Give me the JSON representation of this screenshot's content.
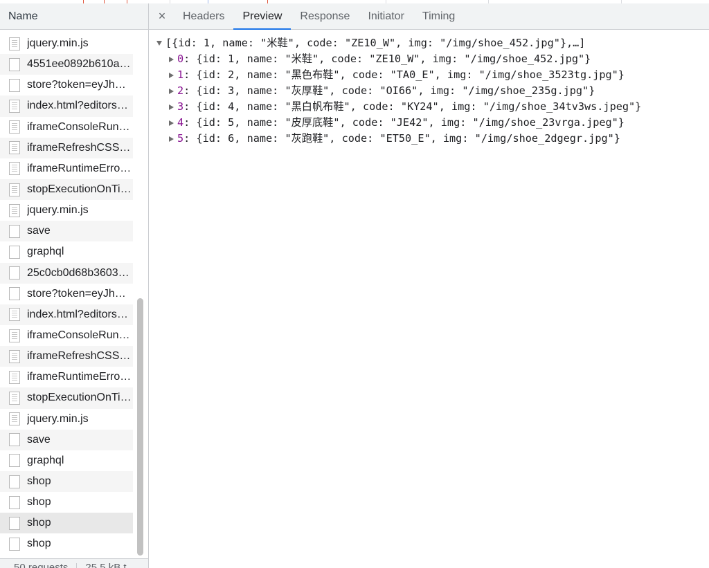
{
  "name_panel": {
    "header": "Name",
    "requests": [
      {
        "name": "jquery.min.js",
        "icon": "script-file-icon"
      },
      {
        "name": "4551ee0892b610a…",
        "icon": "document-file-icon"
      },
      {
        "name": "store?token=eyJhb…",
        "icon": "document-file-icon"
      },
      {
        "name": "index.html?editors…",
        "icon": "script-file-icon"
      },
      {
        "name": "iframeConsoleRun…",
        "icon": "script-file-icon"
      },
      {
        "name": "iframeRefreshCSS-…",
        "icon": "script-file-icon"
      },
      {
        "name": "iframeRuntimeError…",
        "icon": "script-file-icon"
      },
      {
        "name": "stopExecutionOnTi…",
        "icon": "script-file-icon"
      },
      {
        "name": "jquery.min.js",
        "icon": "script-file-icon"
      },
      {
        "name": "save",
        "icon": "document-file-icon"
      },
      {
        "name": "graphql",
        "icon": "document-file-icon"
      },
      {
        "name": "25c0cb0d68b3603…",
        "icon": "document-file-icon"
      },
      {
        "name": "store?token=eyJhb…",
        "icon": "document-file-icon"
      },
      {
        "name": "index.html?editors…",
        "icon": "script-file-icon"
      },
      {
        "name": "iframeConsoleRun…",
        "icon": "script-file-icon"
      },
      {
        "name": "iframeRefreshCSS-…",
        "icon": "script-file-icon"
      },
      {
        "name": "iframeRuntimeError…",
        "icon": "script-file-icon"
      },
      {
        "name": "stopExecutionOnTi…",
        "icon": "script-file-icon"
      },
      {
        "name": "jquery.min.js",
        "icon": "script-file-icon"
      },
      {
        "name": "save",
        "icon": "document-file-icon"
      },
      {
        "name": "graphql",
        "icon": "document-file-icon"
      },
      {
        "name": "shop",
        "icon": "document-file-icon"
      },
      {
        "name": "shop",
        "icon": "document-file-icon"
      },
      {
        "name": "shop",
        "icon": "document-file-icon"
      },
      {
        "name": "shop",
        "icon": "document-file-icon"
      }
    ],
    "selected_index": 23,
    "status": {
      "requests": "50 requests",
      "transferred": "25.5 kB t"
    }
  },
  "detail_panel": {
    "close_label": "×",
    "tabs": [
      "Headers",
      "Preview",
      "Response",
      "Initiator",
      "Timing"
    ],
    "active_tab": "Preview",
    "preview": {
      "summary": "[{id: 1, name: \"米鞋\", code: \"ZE10_W\", img: \"/img/shoe_452.jpg\"},…]",
      "items": [
        {
          "key": "0",
          "value": ": {id: 1, name: \"米鞋\", code: \"ZE10_W\", img: \"/img/shoe_452.jpg\"}"
        },
        {
          "key": "1",
          "value": ": {id: 2, name: \"黑色布鞋\", code: \"TA0_E\", img: \"/img/shoe_3523tg.jpg\"}"
        },
        {
          "key": "2",
          "value": ": {id: 3, name: \"灰厚鞋\", code: \"OI66\", img: \"/img/shoe_235g.jpg\"}"
        },
        {
          "key": "3",
          "value": ": {id: 4, name: \"黑白帆布鞋\", code: \"KY24\", img: \"/img/shoe_34tv3ws.jpeg\"}"
        },
        {
          "key": "4",
          "value": ": {id: 5, name: \"皮厚底鞋\", code: \"JE42\", img: \"/img/shoe_23vrga.jpeg\"}"
        },
        {
          "key": "5",
          "value": ": {id: 6, name: \"灰跑鞋\", code: \"ET50_E\", img: \"/img/shoe_2dgegr.jpg\"}"
        }
      ]
    }
  },
  "colors": {
    "active_tab_underline": "#1a73e8",
    "object_key": "#881391",
    "panel_header_bg": "#f1f3f4"
  }
}
